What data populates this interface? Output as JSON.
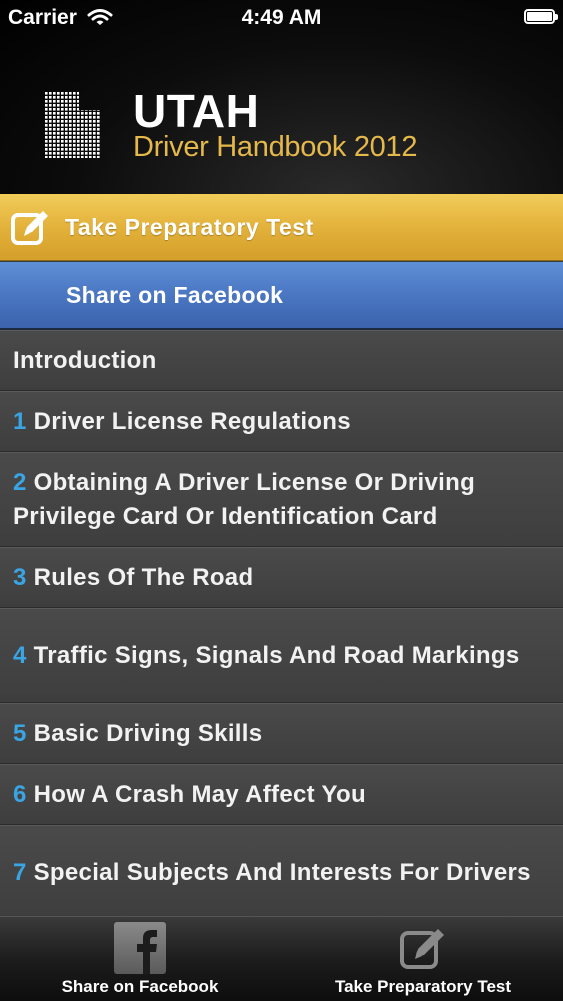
{
  "status_bar": {
    "carrier": "Carrier",
    "time": "4:49 AM"
  },
  "header": {
    "title": "UTAH",
    "subtitle": "Driver Handbook 2012"
  },
  "actions": {
    "test_label": "Take Preparatory Test",
    "facebook_label": "Share on Facebook"
  },
  "chapters": [
    {
      "num": "",
      "title": "Introduction"
    },
    {
      "num": "1",
      "title": "Driver License Regulations"
    },
    {
      "num": "2",
      "title": "Obtaining A Driver License Or Driving Privilege Card Or Identification Card"
    },
    {
      "num": "3",
      "title": "Rules Of The Road"
    },
    {
      "num": "4",
      "title": "Traffic Signs, Signals And Road Markings"
    },
    {
      "num": "5",
      "title": "Basic Driving Skills"
    },
    {
      "num": "6",
      "title": "How A Crash May Affect You"
    },
    {
      "num": "7",
      "title": "Special Subjects And Interests For Drivers"
    }
  ],
  "tabbar": {
    "facebook_label": "Share on Facebook",
    "test_label": "Take Preparatory Test"
  },
  "colors": {
    "accent_gold": "#e4b84a",
    "facebook_blue": "#4a76c2",
    "chapter_number": "#3aa5e4"
  },
  "icons": [
    "wifi-icon",
    "battery-icon",
    "utah-map-icon",
    "edit-icon",
    "facebook-icon"
  ]
}
